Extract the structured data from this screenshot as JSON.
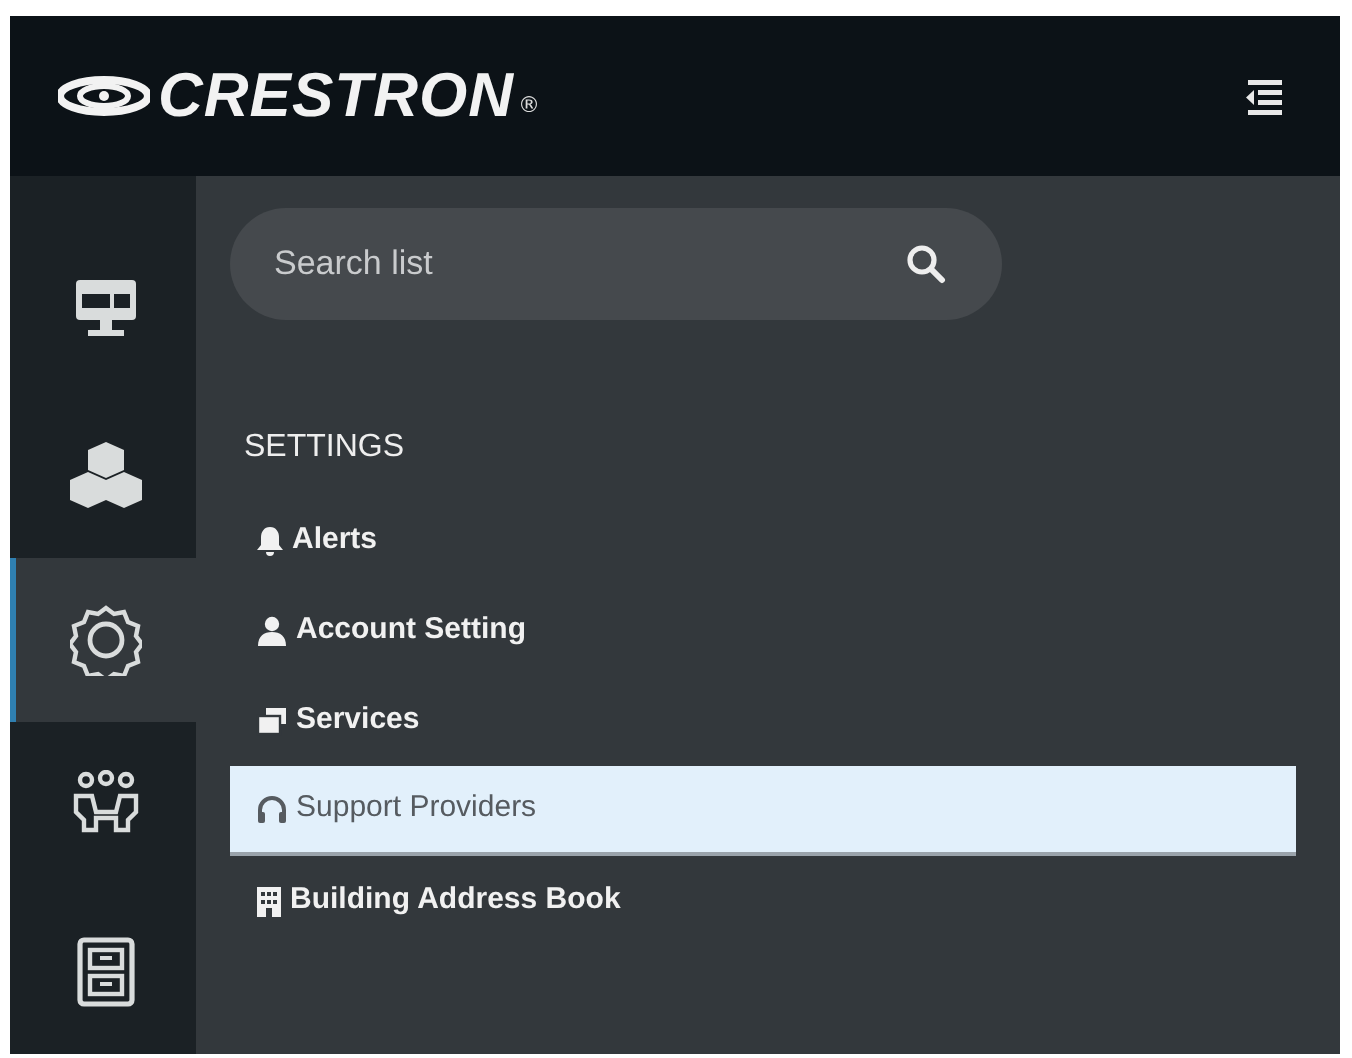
{
  "header": {
    "logo_text": "CRESTRON",
    "registered_mark": "®"
  },
  "rail": [
    {
      "selected": false
    },
    {
      "selected": false
    },
    {
      "selected": true
    },
    {
      "selected": false
    },
    {
      "selected": false
    }
  ],
  "search": {
    "placeholder": "Search list"
  },
  "section": {
    "heading": "SETTINGS"
  },
  "items": [
    {
      "label": "Alerts",
      "selected": false
    },
    {
      "label": "Account Setting",
      "selected": false
    },
    {
      "label": "Services",
      "selected": false
    },
    {
      "label": "Support Providers",
      "selected": true
    },
    {
      "label": "Building Address Book",
      "selected": false
    }
  ]
}
